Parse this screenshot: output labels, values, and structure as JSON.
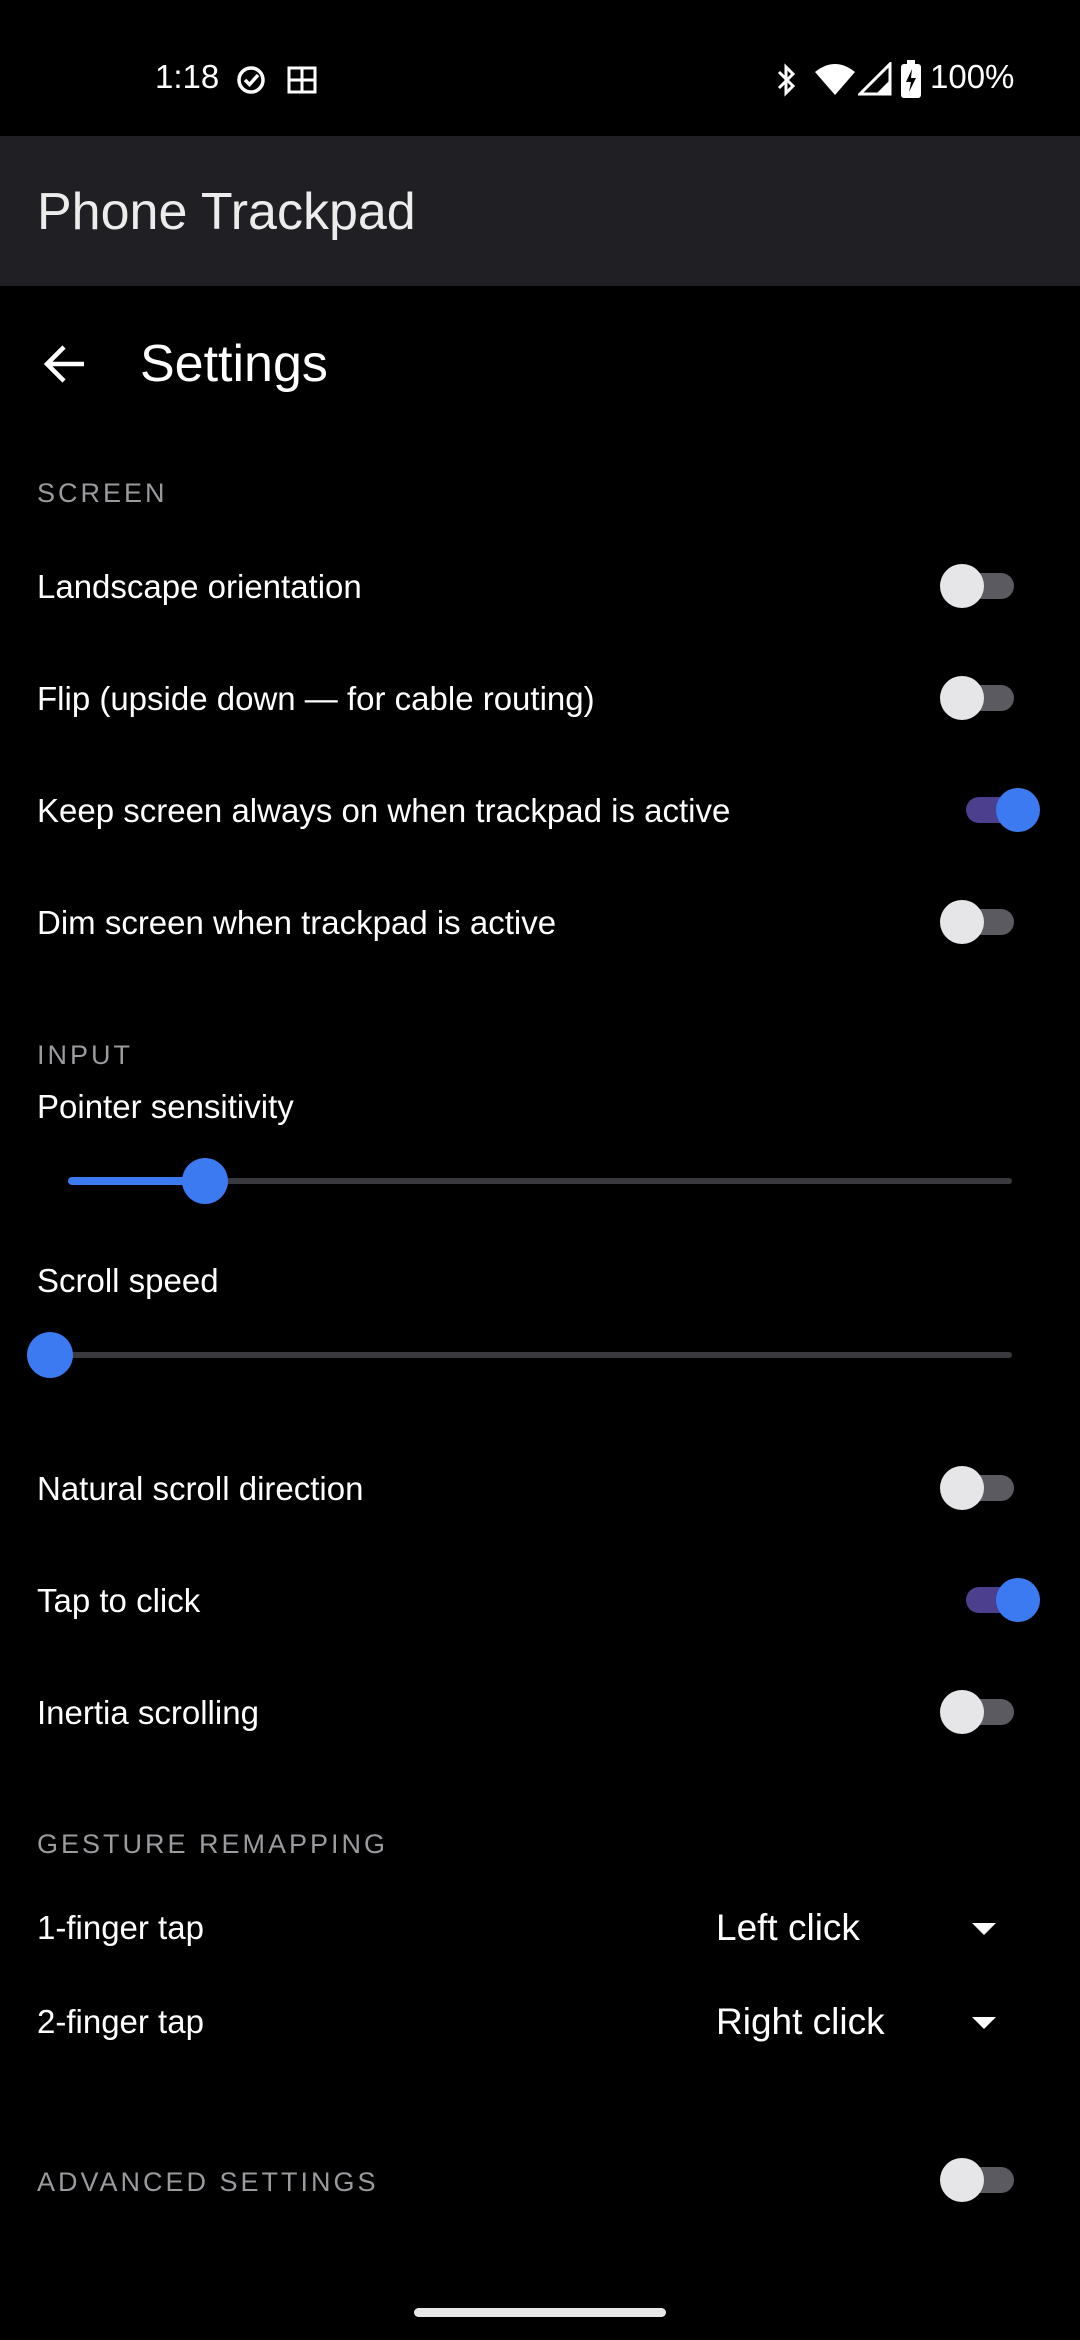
{
  "status_bar": {
    "time": "1:18",
    "battery": "100%",
    "icons": [
      "task-check-icon",
      "grid-icon",
      "bluetooth-icon",
      "wifi-icon",
      "signal-icon",
      "battery-charging-icon"
    ]
  },
  "app_bar": {
    "title": "Phone Trackpad"
  },
  "header": {
    "back_icon": "arrow-left-icon",
    "title": "Settings"
  },
  "sections": {
    "screen": {
      "title": "SCREEN",
      "items": [
        {
          "label": "Landscape orientation",
          "on": false
        },
        {
          "label": "Flip (upside down — for cable routing)",
          "on": false
        },
        {
          "label": "Keep screen always on when trackpad is active",
          "on": true
        },
        {
          "label": "Dim screen when trackpad is active",
          "on": false
        }
      ]
    },
    "input": {
      "title": "INPUT",
      "pointer_sensitivity": {
        "label": "Pointer sensitivity",
        "value_fraction": 0.145
      },
      "scroll_speed": {
        "label": "Scroll speed",
        "value_fraction": 0.0
      },
      "items": [
        {
          "label": "Natural scroll direction",
          "on": false
        },
        {
          "label": "Tap to click",
          "on": true
        },
        {
          "label": "Inertia scrolling",
          "on": false
        }
      ]
    },
    "gesture": {
      "title": "GESTURE REMAPPING",
      "items": [
        {
          "label": "1-finger tap",
          "value": "Left click"
        },
        {
          "label": "2-finger tap",
          "value": "Right click"
        }
      ]
    },
    "advanced": {
      "title": "ADVANCED SETTINGS",
      "on": false
    }
  },
  "colors": {
    "accent": "#3b7af0",
    "switch_on_track": "#4c3f8e",
    "app_bar_bg": "#202024",
    "background": "#000000"
  }
}
